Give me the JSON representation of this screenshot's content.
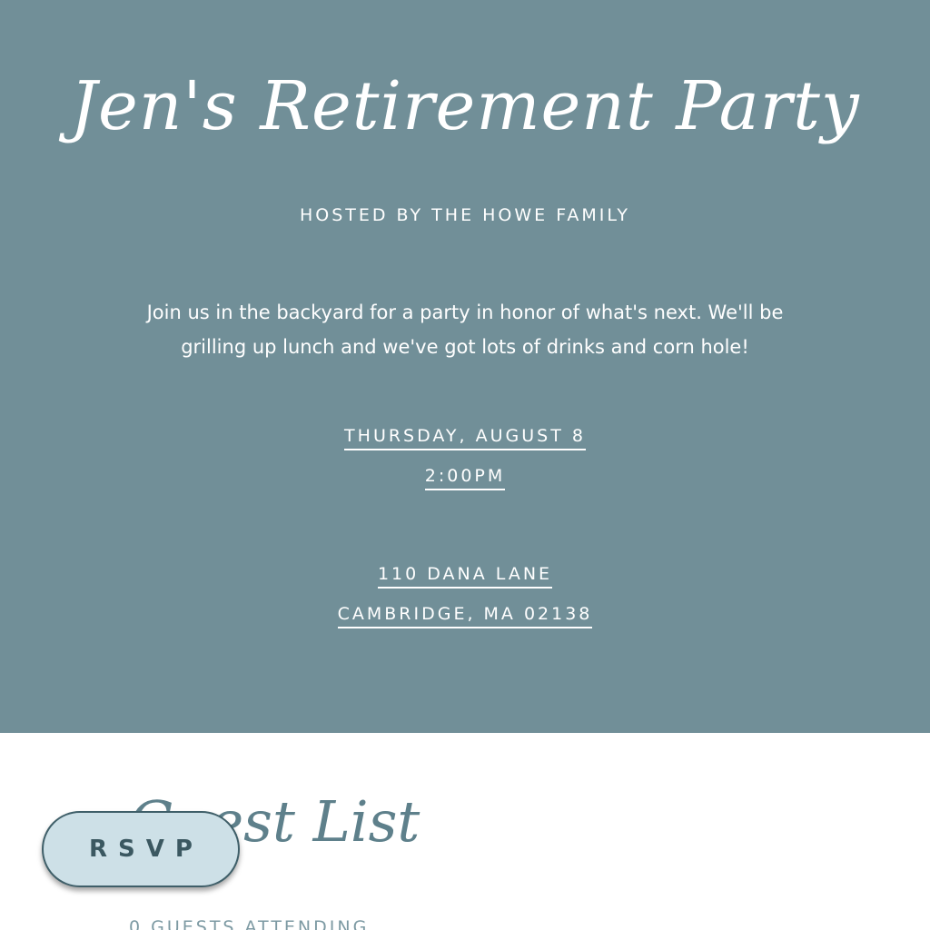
{
  "invite": {
    "title": "Jen's Retirement Party",
    "hosted_by": "HOSTED BY THE HOWE FAMILY",
    "description": "Join us in the backyard for a party in honor of what's next. We'll be grilling up lunch and we've got lots of drinks and corn hole!",
    "date": "THURSDAY, AUGUST 8",
    "time": "2:00PM",
    "address_line1": "110 DANA LANE",
    "address_line2": "CAMBRIDGE, MA 02138"
  },
  "guests": {
    "heading": "Guest List",
    "count_text": "0 GUESTS ATTENDING"
  },
  "rsvp_button": {
    "label": "RSVP"
  },
  "colors": {
    "hero_background": "#718f98",
    "rsvp_background": "#cde0e7",
    "accent_text": "#5e808b"
  }
}
